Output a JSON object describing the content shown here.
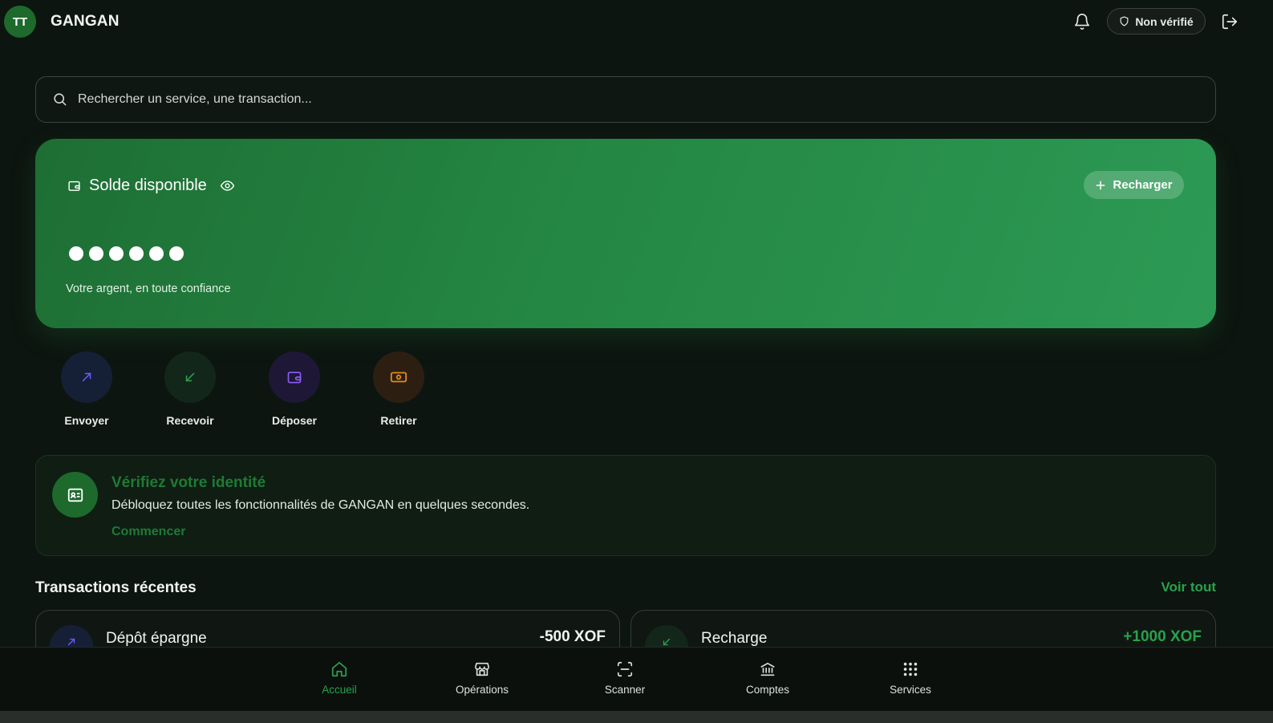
{
  "header": {
    "avatar_initials": "TT",
    "brand": "GANGAN",
    "verify_status": "Non vérifié",
    "icons": [
      "bell-icon",
      "shield-icon",
      "logout-icon"
    ]
  },
  "search": {
    "placeholder": "Rechercher un service, une transaction..."
  },
  "balance": {
    "label": "Solde disponible",
    "masked_value": "••••••",
    "tagline": "Votre argent, en toute confiance",
    "recharge_label": "Recharger"
  },
  "actions": [
    {
      "label": "Envoyer",
      "icon": "arrow-up-right-icon",
      "color": "#6d5cff"
    },
    {
      "label": "Recevoir",
      "icon": "arrow-down-left-icon",
      "color": "#2fa24f"
    },
    {
      "label": "Déposer",
      "icon": "wallet-icon",
      "color": "#8b5cf6"
    },
    {
      "label": "Retirer",
      "icon": "banknote-icon",
      "color": "#e08a1e"
    }
  ],
  "kyc": {
    "title": "Vérifiez votre identité",
    "description": "Débloquez toutes les fonctionnalités de GANGAN en quelques secondes.",
    "cta": "Commencer"
  },
  "transactions": {
    "title": "Transactions récentes",
    "view_all": "Voir tout",
    "items": [
      {
        "name": "Dépôt épargne",
        "amount": "-500 XOF",
        "amount_color": "#f1f5f1",
        "icon": "arrow-up-right-icon"
      },
      {
        "name": "Recharge",
        "amount": "+1000 XOF",
        "amount_color": "#27a24c",
        "icon": "arrow-down-left-icon"
      }
    ]
  },
  "nav": {
    "active": "Accueil",
    "items": [
      {
        "label": "Accueil",
        "icon": "home-icon"
      },
      {
        "label": "Opérations",
        "icon": "store-icon"
      },
      {
        "label": "Scanner",
        "icon": "scan-icon"
      },
      {
        "label": "Comptes",
        "icon": "bank-icon"
      },
      {
        "label": "Services",
        "icon": "grid-icon"
      }
    ]
  },
  "colors": {
    "background": "#0d1510",
    "accent": "#27a24c",
    "card_green": "#248743"
  }
}
